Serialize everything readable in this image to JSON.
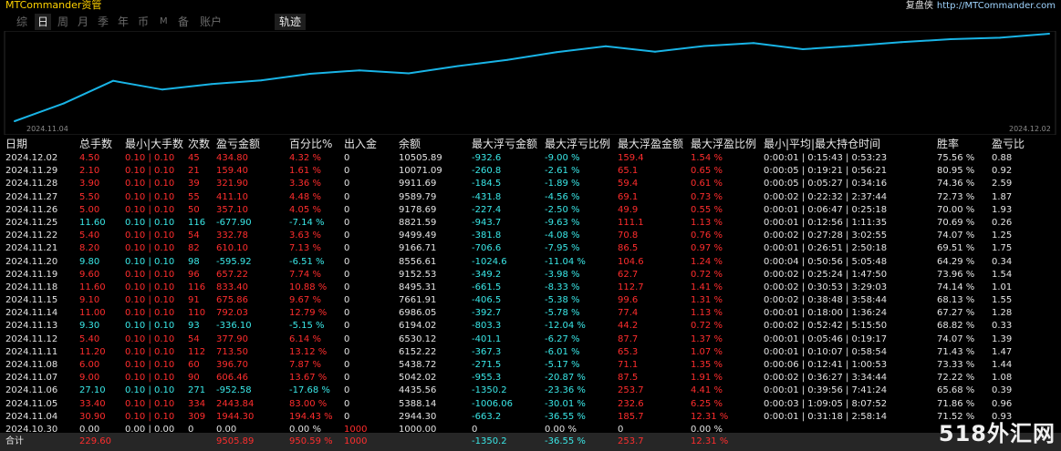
{
  "app": {
    "title": "MTCommander资管",
    "right_label": "复盘侠",
    "right_url": "http://MTCommander.com"
  },
  "tabs": [
    "综",
    "日",
    "周",
    "月",
    "季",
    "年",
    "币",
    "M",
    "备",
    "账户"
  ],
  "active_tab": "日",
  "track_label": "轨迹",
  "chart_data": {
    "type": "line",
    "x_start_label": "2024.11.04",
    "x_end_label": "2024.12.02",
    "color": "#19b4e6",
    "x": [
      "2024.10.30",
      "2024.11.04",
      "2024.11.05",
      "2024.11.06",
      "2024.11.07",
      "2024.11.08",
      "2024.11.11",
      "2024.11.12",
      "2024.11.13",
      "2024.11.14",
      "2024.11.15",
      "2024.11.18",
      "2024.11.19",
      "2024.11.20",
      "2024.11.21",
      "2024.11.22",
      "2024.11.25",
      "2024.11.26",
      "2024.11.27",
      "2024.11.28",
      "2024.11.29",
      "2024.12.02"
    ],
    "values": [
      1000.0,
      2944.3,
      5388.14,
      4435.56,
      5042.02,
      5438.72,
      6152.22,
      6530.12,
      6194.02,
      6986.05,
      7661.91,
      8495.31,
      9152.53,
      8556.61,
      9166.71,
      9499.49,
      8821.59,
      9178.69,
      9589.79,
      9911.69,
      10071.09,
      10505.89
    ]
  },
  "columns": [
    "日期",
    "总手数",
    "最小|大手数",
    "次数",
    "盈亏金额",
    "百分比%",
    "出入金",
    "余额",
    "最大浮亏金额",
    "最大浮亏比例",
    "最大浮盈金额",
    "最大浮盈比例",
    "最小|平均|最大持仓时间",
    "胜率",
    "盈亏比"
  ],
  "rows": [
    {
      "date": "2024.12.02",
      "lots": "4.50",
      "minmax": "0.10 | 0.10",
      "count": "45",
      "pnl": "434.80",
      "pct": "4.32 %",
      "io": "0",
      "bal": "10505.89",
      "mfl": "-932.6",
      "mflp": "-9.00 %",
      "mfp": "159.4",
      "mfpp": "1.54 %",
      "time": "0:00:01 | 0:15:43 | 0:53:23",
      "win": "75.56 %",
      "ratio": "0.88",
      "neg": false
    },
    {
      "date": "2024.11.29",
      "lots": "2.10",
      "minmax": "0.10 | 0.10",
      "count": "21",
      "pnl": "159.40",
      "pct": "1.61 %",
      "io": "0",
      "bal": "10071.09",
      "mfl": "-260.8",
      "mflp": "-2.61 %",
      "mfp": "65.1",
      "mfpp": "0.65 %",
      "time": "0:00:05 | 0:19:21 | 0:56:21",
      "win": "80.95 %",
      "ratio": "0.92",
      "neg": false
    },
    {
      "date": "2024.11.28",
      "lots": "3.90",
      "minmax": "0.10 | 0.10",
      "count": "39",
      "pnl": "321.90",
      "pct": "3.36 %",
      "io": "0",
      "bal": "9911.69",
      "mfl": "-184.5",
      "mflp": "-1.89 %",
      "mfp": "59.4",
      "mfpp": "0.61 %",
      "time": "0:00:05 | 0:05:27 | 0:34:16",
      "win": "74.36 %",
      "ratio": "2.59",
      "neg": false
    },
    {
      "date": "2024.11.27",
      "lots": "5.50",
      "minmax": "0.10 | 0.10",
      "count": "55",
      "pnl": "411.10",
      "pct": "4.48 %",
      "io": "0",
      "bal": "9589.79",
      "mfl": "-431.8",
      "mflp": "-4.56 %",
      "mfp": "69.1",
      "mfpp": "0.73 %",
      "time": "0:00:02 | 0:22:32 | 2:37:44",
      "win": "72.73 %",
      "ratio": "1.87",
      "neg": false
    },
    {
      "date": "2024.11.26",
      "lots": "5.00",
      "minmax": "0.10 | 0.10",
      "count": "50",
      "pnl": "357.10",
      "pct": "4.05 %",
      "io": "0",
      "bal": "9178.69",
      "mfl": "-227.4",
      "mflp": "-2.50 %",
      "mfp": "49.9",
      "mfpp": "0.55 %",
      "time": "0:00:01 | 0:06:47 | 0:25:18",
      "win": "70.00 %",
      "ratio": "1.93",
      "neg": false
    },
    {
      "date": "2024.11.25",
      "lots": "11.60",
      "minmax": "0.10 | 0.10",
      "count": "116",
      "pnl": "-677.90",
      "pct": "-7.14 %",
      "io": "0",
      "bal": "8821.59",
      "mfl": "-943.7",
      "mflp": "-9.63 %",
      "mfp": "111.1",
      "mfpp": "1.13 %",
      "time": "0:00:01 | 0:12:56 | 1:11:35",
      "win": "70.69 %",
      "ratio": "0.26",
      "neg": true
    },
    {
      "date": "2024.11.22",
      "lots": "5.40",
      "minmax": "0.10 | 0.10",
      "count": "54",
      "pnl": "332.78",
      "pct": "3.63 %",
      "io": "0",
      "bal": "9499.49",
      "mfl": "-381.8",
      "mflp": "-4.08 %",
      "mfp": "70.8",
      "mfpp": "0.76 %",
      "time": "0:00:02 | 0:27:28 | 3:02:55",
      "win": "74.07 %",
      "ratio": "1.25",
      "neg": false
    },
    {
      "date": "2024.11.21",
      "lots": "8.20",
      "minmax": "0.10 | 0.10",
      "count": "82",
      "pnl": "610.10",
      "pct": "7.13 %",
      "io": "0",
      "bal": "9166.71",
      "mfl": "-706.6",
      "mflp": "-7.95 %",
      "mfp": "86.5",
      "mfpp": "0.97 %",
      "time": "0:00:01 | 0:26:51 | 2:50:18",
      "win": "69.51 %",
      "ratio": "1.75",
      "neg": false
    },
    {
      "date": "2024.11.20",
      "lots": "9.80",
      "minmax": "0.10 | 0.10",
      "count": "98",
      "pnl": "-595.92",
      "pct": "-6.51 %",
      "io": "0",
      "bal": "8556.61",
      "mfl": "-1024.6",
      "mflp": "-11.04 %",
      "mfp": "104.6",
      "mfpp": "1.24 %",
      "time": "0:00:04 | 0:50:56 | 5:05:48",
      "win": "64.29 %",
      "ratio": "0.34",
      "neg": true
    },
    {
      "date": "2024.11.19",
      "lots": "9.60",
      "minmax": "0.10 | 0.10",
      "count": "96",
      "pnl": "657.22",
      "pct": "7.74 %",
      "io": "0",
      "bal": "9152.53",
      "mfl": "-349.2",
      "mflp": "-3.98 %",
      "mfp": "62.7",
      "mfpp": "0.72 %",
      "time": "0:00:02 | 0:25:24 | 1:47:50",
      "win": "73.96 %",
      "ratio": "1.54",
      "neg": false
    },
    {
      "date": "2024.11.18",
      "lots": "11.60",
      "minmax": "0.10 | 0.10",
      "count": "116",
      "pnl": "833.40",
      "pct": "10.88 %",
      "io": "0",
      "bal": "8495.31",
      "mfl": "-661.5",
      "mflp": "-8.33 %",
      "mfp": "112.7",
      "mfpp": "1.41 %",
      "time": "0:00:02 | 0:30:53 | 3:29:03",
      "win": "74.14 %",
      "ratio": "1.01",
      "neg": false
    },
    {
      "date": "2024.11.15",
      "lots": "9.10",
      "minmax": "0.10 | 0.10",
      "count": "91",
      "pnl": "675.86",
      "pct": "9.67 %",
      "io": "0",
      "bal": "7661.91",
      "mfl": "-406.5",
      "mflp": "-5.38 %",
      "mfp": "99.6",
      "mfpp": "1.31 %",
      "time": "0:00:02 | 0:38:48 | 3:58:44",
      "win": "68.13 %",
      "ratio": "1.55",
      "neg": false
    },
    {
      "date": "2024.11.14",
      "lots": "11.00",
      "minmax": "0.10 | 0.10",
      "count": "110",
      "pnl": "792.03",
      "pct": "12.79 %",
      "io": "0",
      "bal": "6986.05",
      "mfl": "-392.7",
      "mflp": "-5.78 %",
      "mfp": "77.4",
      "mfpp": "1.13 %",
      "time": "0:00:01 | 0:18:00 | 1:36:24",
      "win": "67.27 %",
      "ratio": "1.28",
      "neg": false
    },
    {
      "date": "2024.11.13",
      "lots": "9.30",
      "minmax": "0.10 | 0.10",
      "count": "93",
      "pnl": "-336.10",
      "pct": "-5.15 %",
      "io": "0",
      "bal": "6194.02",
      "mfl": "-803.3",
      "mflp": "-12.04 %",
      "mfp": "44.2",
      "mfpp": "0.72 %",
      "time": "0:00:02 | 0:52:42 | 5:15:50",
      "win": "68.82 %",
      "ratio": "0.33",
      "neg": true
    },
    {
      "date": "2024.11.12",
      "lots": "5.40",
      "minmax": "0.10 | 0.10",
      "count": "54",
      "pnl": "377.90",
      "pct": "6.14 %",
      "io": "0",
      "bal": "6530.12",
      "mfl": "-401.1",
      "mflp": "-6.27 %",
      "mfp": "87.7",
      "mfpp": "1.37 %",
      "time": "0:00:01 | 0:05:46 | 0:19:17",
      "win": "74.07 %",
      "ratio": "1.39",
      "neg": false
    },
    {
      "date": "2024.11.11",
      "lots": "11.20",
      "minmax": "0.10 | 0.10",
      "count": "112",
      "pnl": "713.50",
      "pct": "13.12 %",
      "io": "0",
      "bal": "6152.22",
      "mfl": "-367.3",
      "mflp": "-6.01 %",
      "mfp": "65.3",
      "mfpp": "1.07 %",
      "time": "0:00:01 | 0:10:07 | 0:58:54",
      "win": "71.43 %",
      "ratio": "1.47",
      "neg": false
    },
    {
      "date": "2024.11.08",
      "lots": "6.00",
      "minmax": "0.10 | 0.10",
      "count": "60",
      "pnl": "396.70",
      "pct": "7.87 %",
      "io": "0",
      "bal": "5438.72",
      "mfl": "-271.5",
      "mflp": "-5.17 %",
      "mfp": "71.1",
      "mfpp": "1.35 %",
      "time": "0:00:06 | 0:12:41 | 1:00:53",
      "win": "73.33 %",
      "ratio": "1.44",
      "neg": false
    },
    {
      "date": "2024.11.07",
      "lots": "9.00",
      "minmax": "0.10 | 0.10",
      "count": "90",
      "pnl": "606.46",
      "pct": "13.67 %",
      "io": "0",
      "bal": "5042.02",
      "mfl": "-955.3",
      "mflp": "-20.87 %",
      "mfp": "87.5",
      "mfpp": "1.91 %",
      "time": "0:00:02 | 0:36:27 | 3:34:44",
      "win": "72.22 %",
      "ratio": "1.08",
      "neg": false
    },
    {
      "date": "2024.11.06",
      "lots": "27.10",
      "minmax": "0.10 | 0.10",
      "count": "271",
      "pnl": "-952.58",
      "pct": "-17.68 %",
      "io": "0",
      "bal": "4435.56",
      "mfl": "-1350.2",
      "mflp": "-23.36 %",
      "mfp": "253.7",
      "mfpp": "4.41 %",
      "time": "0:00:01 | 0:39:56 | 7:41:24",
      "win": "65.68 %",
      "ratio": "0.39",
      "neg": true
    },
    {
      "date": "2024.11.05",
      "lots": "33.40",
      "minmax": "0.10 | 0.10",
      "count": "334",
      "pnl": "2443.84",
      "pct": "83.00 %",
      "io": "0",
      "bal": "5388.14",
      "mfl": "-1006.06",
      "mflp": "-30.01 %",
      "mfp": "232.6",
      "mfpp": "6.25 %",
      "time": "0:00:03 | 1:09:05 | 8:07:52",
      "win": "71.86 %",
      "ratio": "0.96",
      "neg": false
    },
    {
      "date": "2024.11.04",
      "lots": "30.90",
      "minmax": "0.10 | 0.10",
      "count": "309",
      "pnl": "1944.30",
      "pct": "194.43 %",
      "io": "0",
      "bal": "2944.30",
      "mfl": "-663.2",
      "mflp": "-36.55 %",
      "mfp": "185.7",
      "mfpp": "12.31 %",
      "time": "0:00:01 | 0:31:18 | 2:58:14",
      "win": "71.52 %",
      "ratio": "0.93",
      "neg": false
    },
    {
      "date": "2024.10.30",
      "lots": "0.00",
      "minmax": "0.00 | 0.00",
      "count": "0",
      "pnl": "0.00",
      "pct": "0.00 %",
      "io": "1000",
      "bal": "1000.00",
      "mfl": "0",
      "mflp": "0.00 %",
      "mfp": "0",
      "mfpp": "0.00 %",
      "time": "",
      "win": "",
      "ratio": "",
      "neg": false,
      "zero": true
    }
  ],
  "totals": {
    "label": "合计",
    "lots": "229.60",
    "pnl": "9505.89",
    "pct": "950.59 %",
    "io": "1000",
    "mfl": "-1350.2",
    "mflp": "-36.55 %",
    "mfp": "253.7",
    "mfpp": "12.31 %"
  },
  "watermark": "518外汇网",
  "colors": {
    "positive": "#ff2d2d",
    "negative": "#3ae8e8",
    "line": "#19b4e6",
    "title": "#ffd200"
  }
}
